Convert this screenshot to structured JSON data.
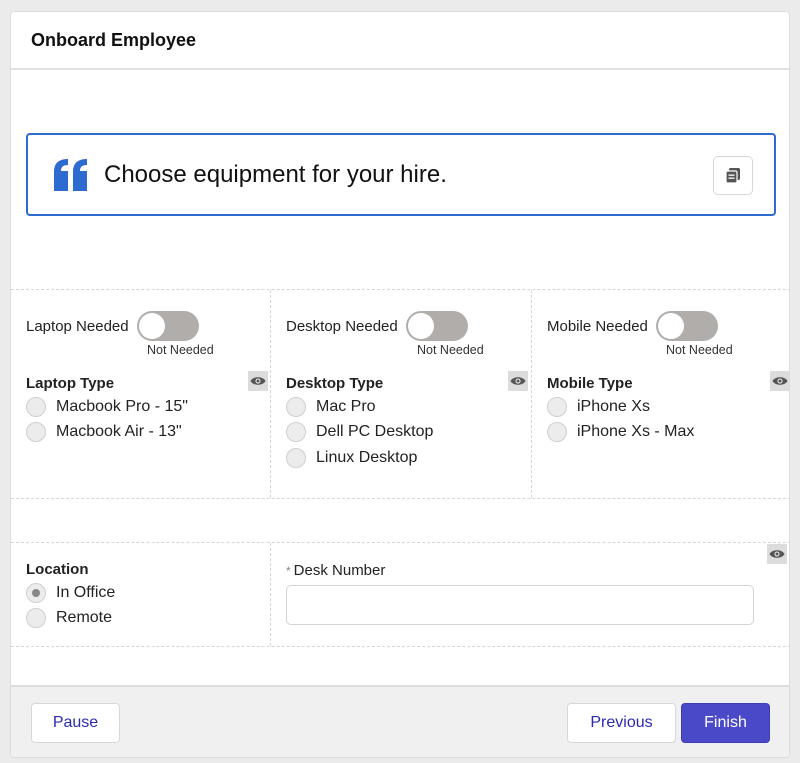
{
  "header": {
    "title": "Onboard Employee"
  },
  "quote": {
    "text": "Choose equipment for your hire.",
    "icon": "quote-icon",
    "copy_icon": "copy-icon",
    "accent_color": "#2e6bd0"
  },
  "equipment": [
    {
      "toggle_label": "Laptop Needed",
      "toggle_status": "Not Needed",
      "toggle_on": false,
      "group_label": "Laptop Type",
      "options": [
        "Macbook Pro - 15\"",
        "Macbook Air - 13\""
      ]
    },
    {
      "toggle_label": "Desktop Needed",
      "toggle_status": "Not Needed",
      "toggle_on": false,
      "group_label": "Desktop Type",
      "options": [
        "Mac Pro",
        "Dell PC Desktop",
        "Linux Desktop"
      ]
    },
    {
      "toggle_label": "Mobile Needed",
      "toggle_status": "Not Needed",
      "toggle_on": false,
      "group_label": "Mobile Type",
      "options": [
        "iPhone Xs",
        "iPhone Xs - Max"
      ]
    }
  ],
  "location": {
    "label": "Location",
    "options": [
      "In Office",
      "Remote"
    ],
    "selected": "In Office"
  },
  "desk_number": {
    "required_marker": "*",
    "label": "Desk Number",
    "value": "",
    "placeholder": ""
  },
  "footer": {
    "pause_label": "Pause",
    "previous_label": "Previous",
    "finish_label": "Finish",
    "brand_color": "#4a4ac8"
  }
}
